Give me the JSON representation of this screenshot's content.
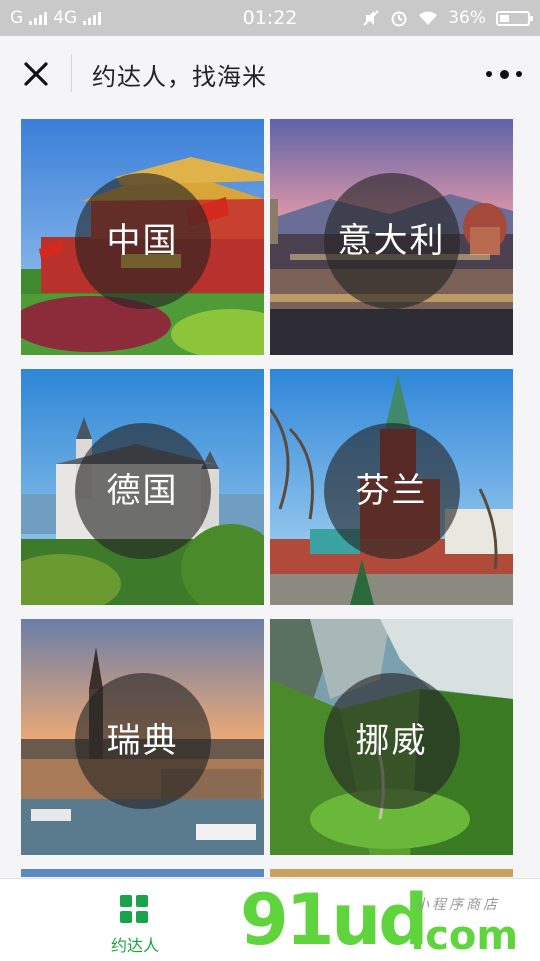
{
  "status_bar": {
    "carrier1": "G",
    "carrier2": "4G",
    "time": "01:22",
    "battery": "36%",
    "battery_level": 0.36,
    "icons": [
      "signal-icon",
      "mute-icon",
      "alarm-icon",
      "wifi-icon",
      "battery-icon"
    ]
  },
  "nav": {
    "title": "约达人，找海米",
    "close_icon": "close-icon",
    "more_icon": "more-icon"
  },
  "countries": [
    {
      "label": "中国"
    },
    {
      "label": "意大利"
    },
    {
      "label": "德国"
    },
    {
      "label": "芬兰"
    },
    {
      "label": "瑞典"
    },
    {
      "label": "挪威"
    }
  ],
  "tab_bar": {
    "items": [
      {
        "label": "约达人",
        "icon": "grid-icon",
        "active": true
      }
    ]
  },
  "watermark": {
    "brand": "91ud",
    "suffix": ".com",
    "tagline": "小程序商店"
  },
  "colors": {
    "accent": "#1aa33f",
    "watermark": "#5fd43c",
    "status_bar": "#c9c9c9"
  }
}
